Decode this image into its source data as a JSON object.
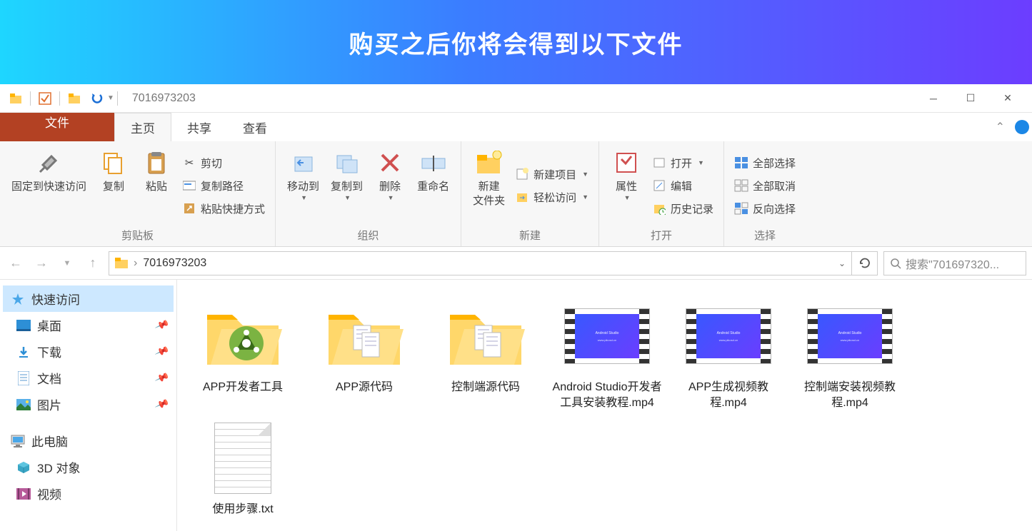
{
  "banner": {
    "text": "购买之后你将会得到以下文件"
  },
  "titlebar": {
    "path": "7016973203"
  },
  "tabs": {
    "file": "文件",
    "home": "主页",
    "share": "共享",
    "view": "查看"
  },
  "ribbon": {
    "clipboard": {
      "pin": "固定到快速访问",
      "copy": "复制",
      "paste": "粘贴",
      "cut": "剪切",
      "copypath": "复制路径",
      "pasteshortcut": "粘贴快捷方式",
      "label": "剪贴板"
    },
    "organize": {
      "moveto": "移动到",
      "copyto": "复制到",
      "delete": "删除",
      "rename": "重命名",
      "label": "组织"
    },
    "new": {
      "newfolder": "新建\n文件夹",
      "newitem": "新建项目",
      "easyaccess": "轻松访问",
      "label": "新建"
    },
    "open": {
      "properties": "属性",
      "open": "打开",
      "edit": "编辑",
      "history": "历史记录",
      "label": "打开"
    },
    "select": {
      "selectall": "全部选择",
      "selectnone": "全部取消",
      "invert": "反向选择",
      "label": "选择"
    }
  },
  "nav": {
    "crumb": "7016973203",
    "search_placeholder": "搜索\"701697320..."
  },
  "sidebar": {
    "quick": "快速访问",
    "desktop": "桌面",
    "downloads": "下载",
    "documents": "文档",
    "pictures": "图片",
    "thispc": "此电脑",
    "objects3d": "3D 对象",
    "videos": "视频"
  },
  "files": [
    {
      "name": "APP开发者工具",
      "type": "folder-app"
    },
    {
      "name": "APP源代码",
      "type": "folder-sub"
    },
    {
      "name": "控制端源代码",
      "type": "folder-sub"
    },
    {
      "name": "Android Studio开发者工具安装教程.mp4",
      "type": "video"
    },
    {
      "name": "APP生成视频教程.mp4",
      "type": "video"
    },
    {
      "name": "控制端安装视频教程.mp4",
      "type": "video"
    },
    {
      "name": "使用步骤.txt",
      "type": "txt"
    }
  ]
}
